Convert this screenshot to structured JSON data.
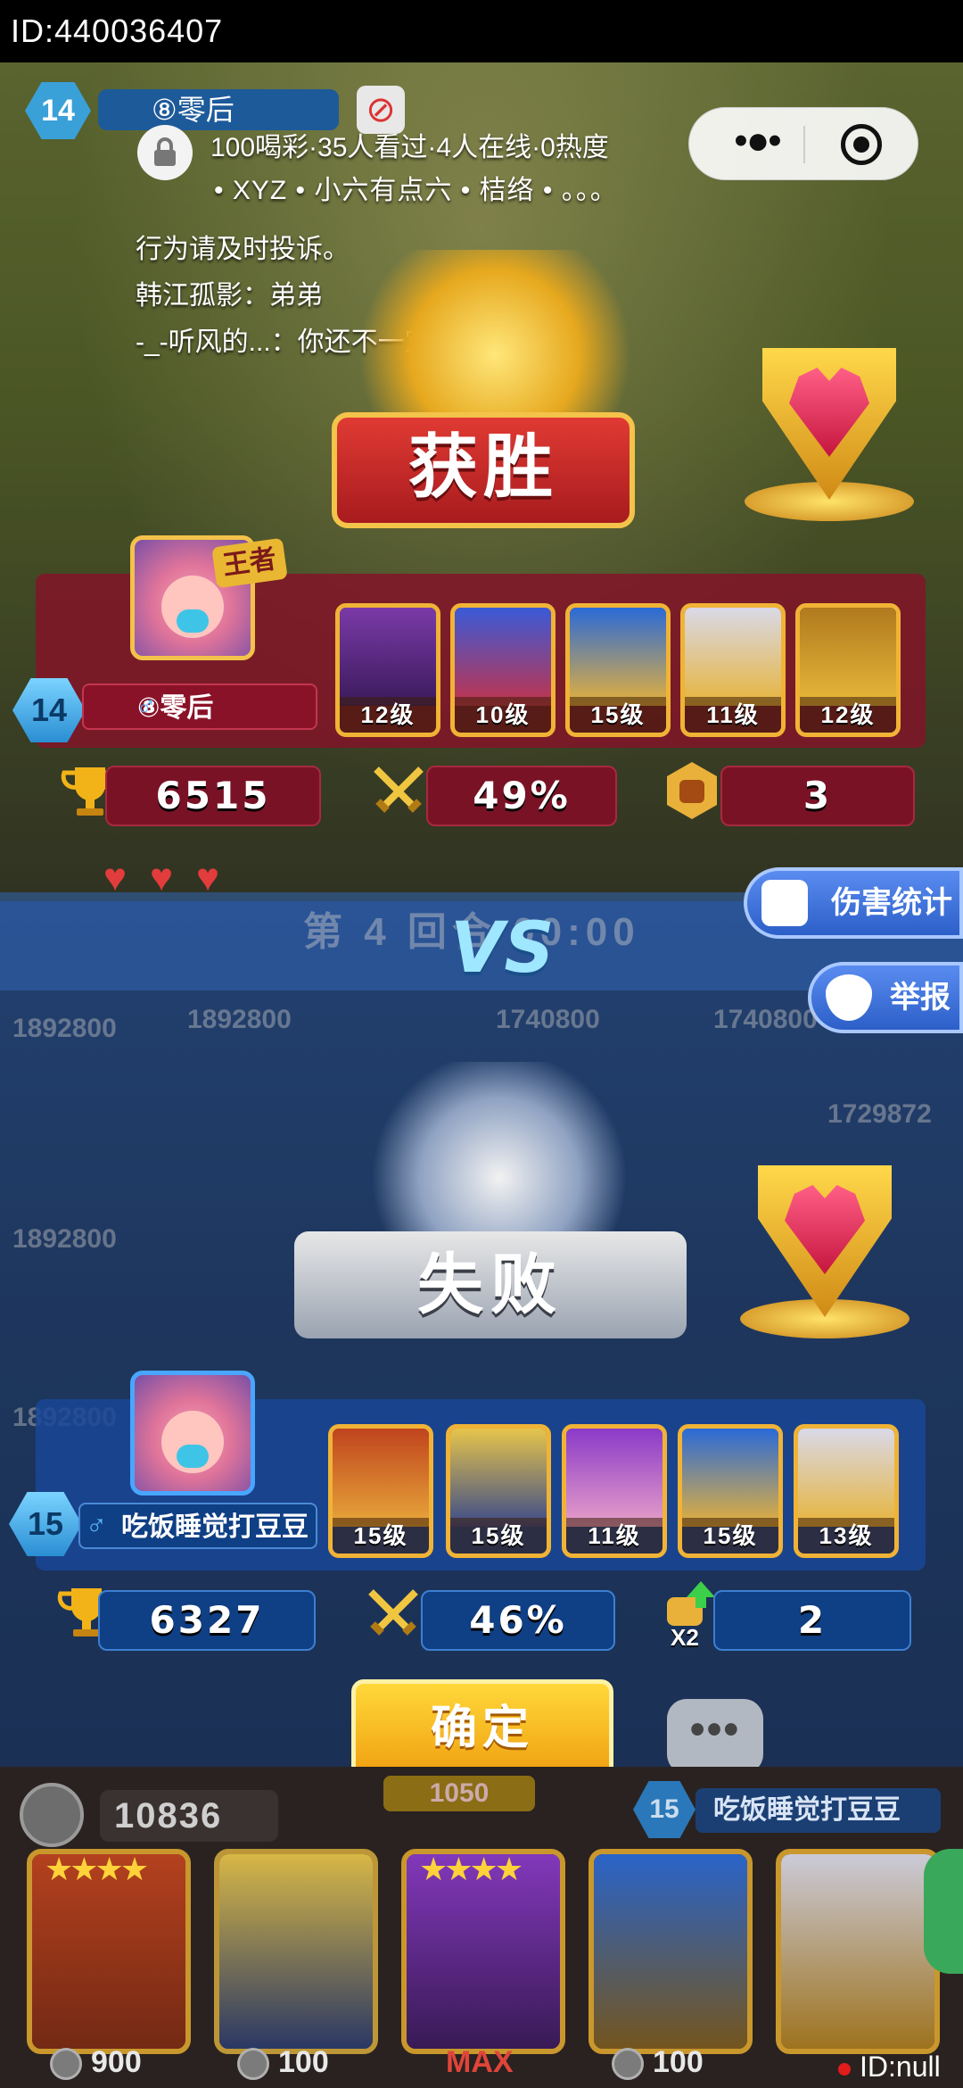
{
  "top_id": "ID:440036407",
  "game_top": {
    "level": "14",
    "name": "⑧零后"
  },
  "live": {
    "title": "100喝彩·35人看过·4人在线·0热度",
    "viewers_line": "• XYZ • 小六有点六 • 桔络 • 。。。",
    "chat": [
      "行为请及时投诉。",
      "韩江孤影：弟弟",
      "-_-听风的...：你还不一定打得过对面"
    ]
  },
  "winner": {
    "banner": "获胜",
    "rank_tag": "王者",
    "level": "14",
    "name": "⑧零后",
    "heroes": [
      {
        "name": "purple-vampire",
        "level": "12级"
      },
      {
        "name": "clown",
        "level": "10级"
      },
      {
        "name": "pharaoh",
        "level": "15级"
      },
      {
        "name": "old-chef",
        "level": "11级"
      },
      {
        "name": "gold-cowboy",
        "level": "12级"
      }
    ],
    "trophies": "6515",
    "win_rate": "49%",
    "fist": "3"
  },
  "middle": {
    "round_text": "第 4 回合 00:00",
    "vs": "VS",
    "damage_stats": "伤害统计",
    "report": "举报",
    "ghost_values": [
      "1892800",
      "1892800",
      "1740800",
      "1740800",
      "1729872",
      "1892800",
      "1892800"
    ]
  },
  "loser": {
    "banner": "失败",
    "level": "15",
    "name": "吃饭睡觉打豆豆",
    "heroes": [
      {
        "name": "monkey-king",
        "level": "15级"
      },
      {
        "name": "robot-king",
        "level": "15级"
      },
      {
        "name": "fan-lady",
        "level": "11级"
      },
      {
        "name": "pharaoh",
        "level": "15级"
      },
      {
        "name": "old-chef",
        "level": "13级"
      }
    ],
    "trophies": "6327",
    "win_rate": "46%",
    "fist": "2",
    "fist_mult": "X2"
  },
  "confirm_label": "确定",
  "chat_bubble": "•••",
  "bottom": {
    "coins": "10836",
    "cost": "1050",
    "level": "15",
    "name": "吃饭睡觉打豆豆",
    "cards": [
      {
        "name": "monkey-king",
        "cost": "900"
      },
      {
        "name": "robot-king",
        "cost": "100"
      },
      {
        "name": "fan-lady",
        "cost": "MAX"
      },
      {
        "name": "pharaoh",
        "cost": "100"
      },
      {
        "name": "old-chef",
        "cost": ""
      }
    ],
    "id_text": "ID:null"
  },
  "colors": {
    "win_panel": "#821428",
    "lose_panel": "#19469a",
    "gold": "#f0b336"
  }
}
